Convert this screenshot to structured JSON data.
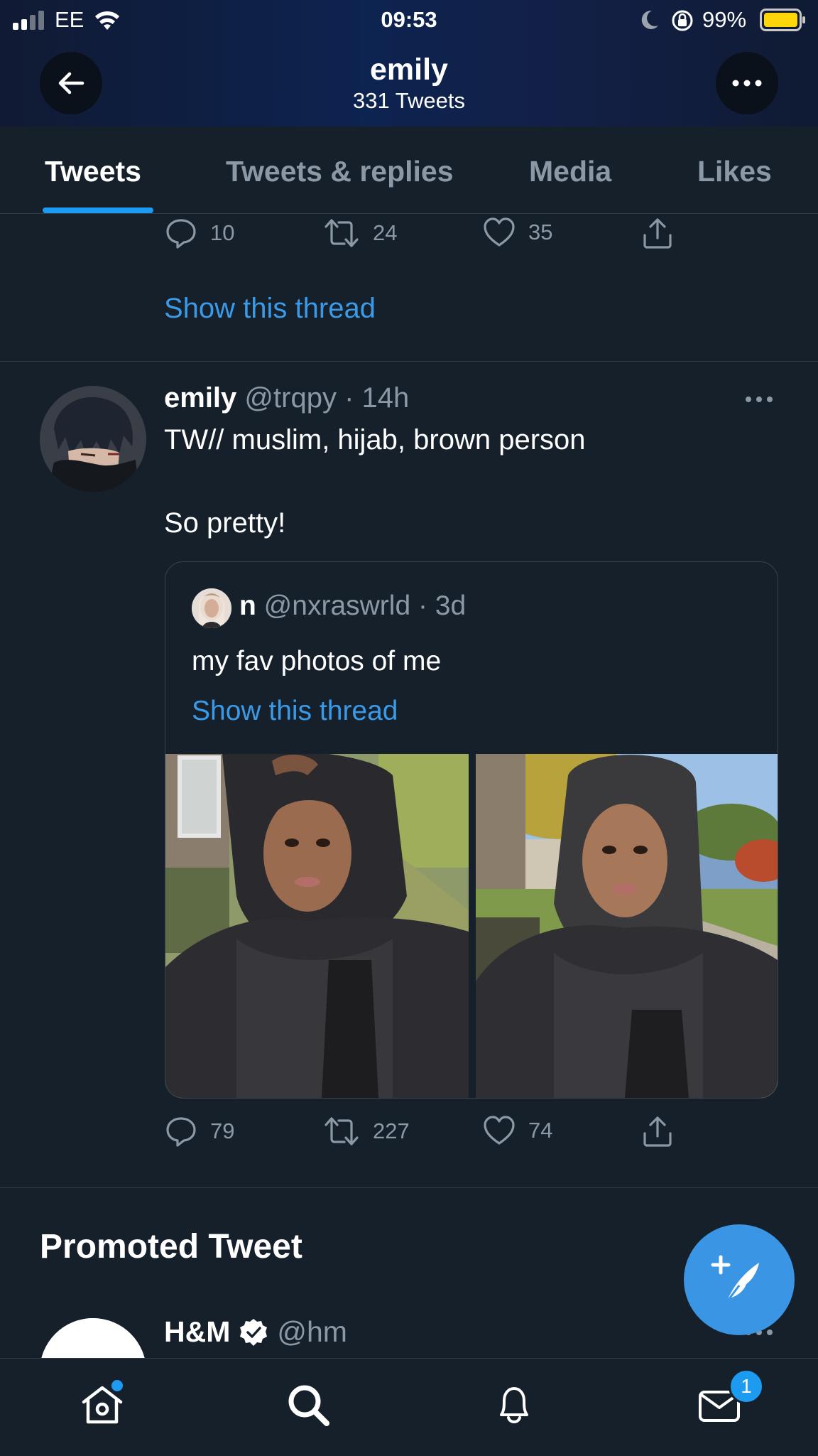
{
  "status_bar": {
    "carrier": "EE",
    "time": "09:53",
    "battery": "99%"
  },
  "header": {
    "name": "emily",
    "tweet_count": "331 Tweets"
  },
  "tabs": [
    {
      "label": "Tweets",
      "active": true
    },
    {
      "label": "Tweets & replies",
      "active": false
    },
    {
      "label": "Media",
      "active": false
    },
    {
      "label": "Likes",
      "active": false
    }
  ],
  "prev_tweet": {
    "replies": "10",
    "retweets": "24",
    "likes": "35",
    "show_thread": "Show this thread"
  },
  "tweet": {
    "name": "emily",
    "handle": "@trqpy",
    "time": "· 14h",
    "text_line1": "TW// muslim, hijab, brown person",
    "text_line2": "So pretty!",
    "replies": "79",
    "retweets": "227",
    "likes": "74"
  },
  "quoted": {
    "name": "n",
    "handle": "@nxraswrld",
    "time": "· 3d",
    "text": "my fav photos of me",
    "show_thread": "Show this thread"
  },
  "promoted": {
    "heading": "Promoted Tweet",
    "name": "H&M",
    "handle": "@hm"
  },
  "notifications": {
    "messages_badge": "1"
  },
  "colors": {
    "background": "#15202b",
    "accent": "#1d9bf0",
    "link": "#3b9ae8",
    "muted": "#8b98a5"
  }
}
